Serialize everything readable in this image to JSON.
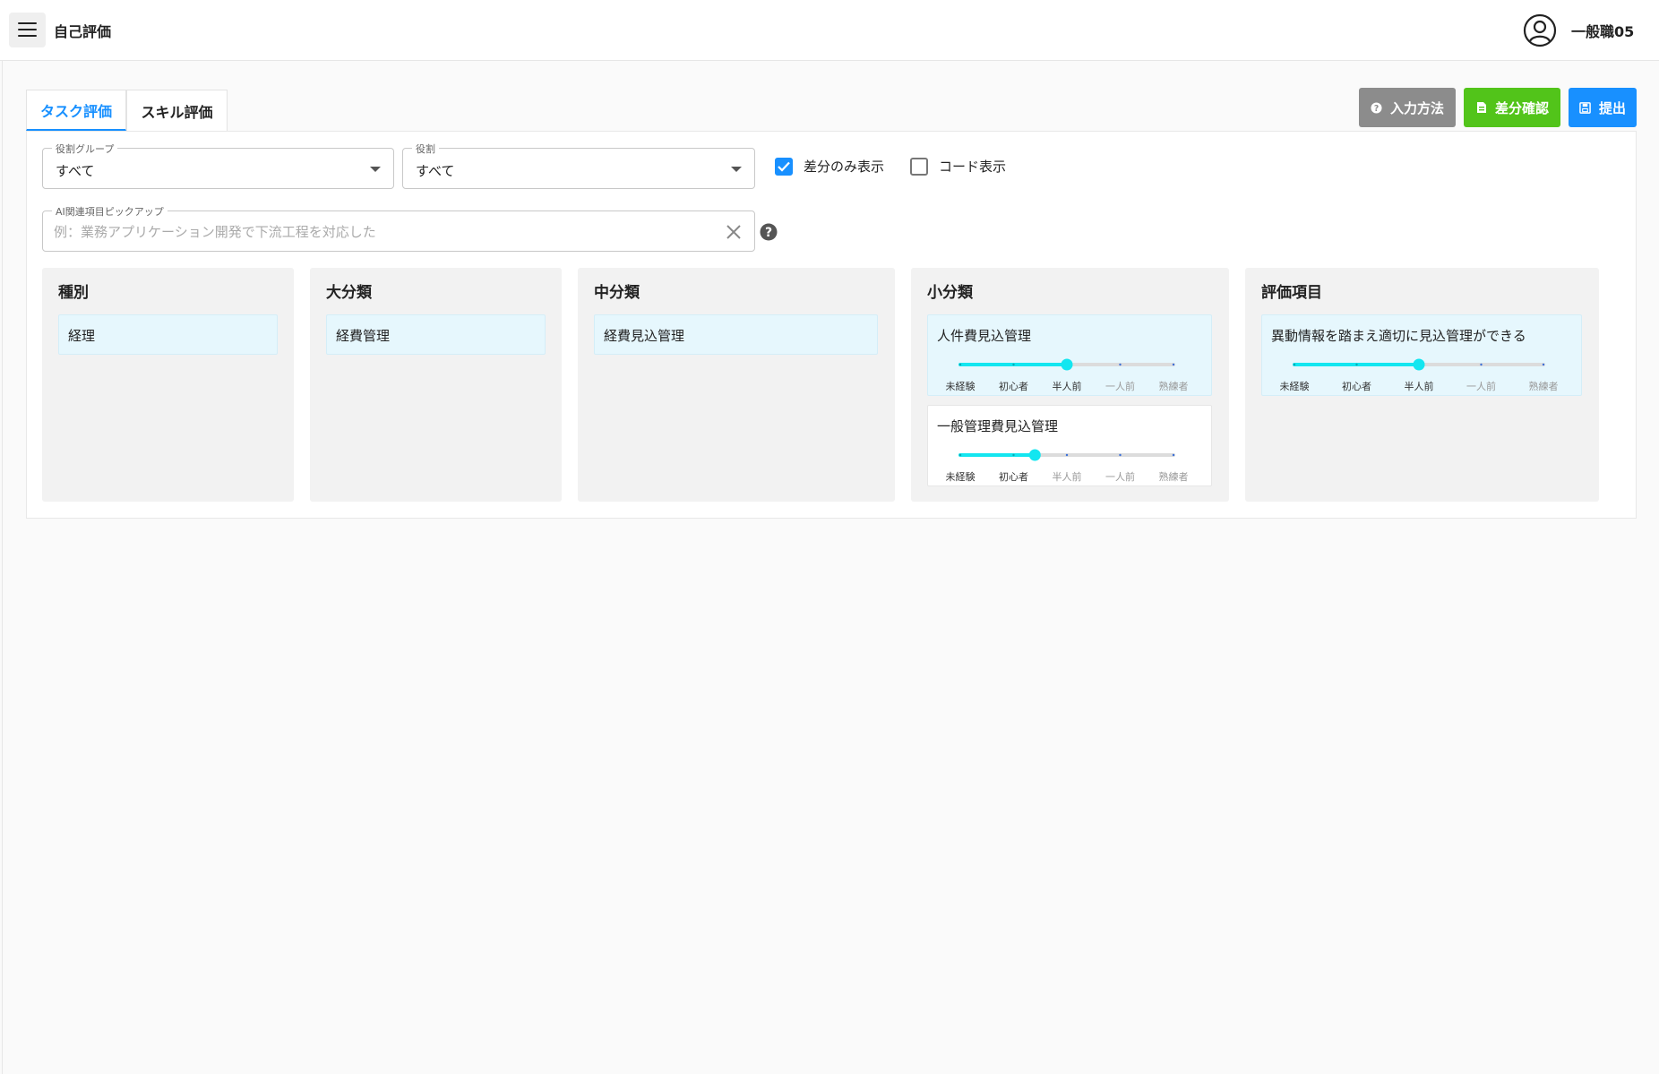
{
  "app": {
    "title": "自己評価",
    "user": "一般職05"
  },
  "tabs": [
    {
      "label": "タスク評価",
      "active": true
    },
    {
      "label": "スキル評価",
      "active": false
    }
  ],
  "toolbar": {
    "help_label": "入力方法",
    "diff_label": "差分確認",
    "submit_label": "提出",
    "help_color": "#8c8c8c",
    "diff_color": "#52c41a",
    "submit_color": "#1890ff"
  },
  "filters": {
    "role_group": {
      "label": "役割グループ",
      "value": "すべて"
    },
    "role": {
      "label": "役割",
      "value": "すべて"
    },
    "diff_only": {
      "label": "差分のみ表示",
      "checked": true
    },
    "show_code": {
      "label": "コード表示",
      "checked": false
    }
  },
  "search": {
    "label": "AI関連項目ピックアップ",
    "placeholder": "例：業務アプリケーション開発で下流工程を対応した",
    "value": ""
  },
  "levels": [
    "未経験",
    "初心者",
    "半人前",
    "一人前",
    "熟練者"
  ],
  "columns": {
    "type": {
      "title": "種別",
      "items": [
        "経理"
      ]
    },
    "major": {
      "title": "大分類",
      "items": [
        "経費管理"
      ]
    },
    "middle": {
      "title": "中分類",
      "items": [
        "経費見込管理"
      ]
    },
    "minor": {
      "title": "小分類",
      "items": [
        {
          "label": "人件費見込管理",
          "level": 2,
          "highlighted": true
        },
        {
          "label": "一般管理費見込管理",
          "level": 1.4,
          "highlighted": false
        }
      ]
    },
    "eval": {
      "title": "評価項目",
      "items": [
        {
          "label": "異動情報を踏まえ適切に見込管理ができる",
          "level": 2,
          "highlighted": true
        }
      ]
    }
  },
  "colors": {
    "accent": "#1890ff",
    "slider": "#13e6f0",
    "item_bg": "#e6f7fd"
  }
}
